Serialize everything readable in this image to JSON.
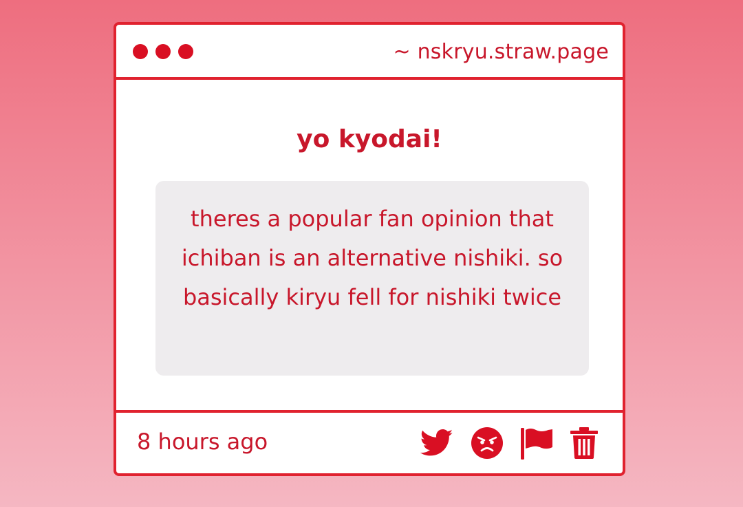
{
  "window": {
    "url": "~ nskryu.straw.page"
  },
  "post": {
    "greeting": "yo kyodai!",
    "message": "theres a popular fan opinion that ichiban is an alternative nishiki. so basically kiryu fell for nishiki twice",
    "timestamp": "8 hours ago"
  },
  "actions": [
    {
      "name": "twitter-share-button",
      "icon": "twitter-icon"
    },
    {
      "name": "angry-reaction-button",
      "icon": "angry-face-icon"
    },
    {
      "name": "report-button",
      "icon": "flag-icon"
    },
    {
      "name": "delete-button",
      "icon": "trash-icon"
    }
  ],
  "colors": {
    "accent": "#d90f23",
    "text": "#c8172b",
    "message_background": "#eeecee",
    "card_background": "#ffffff",
    "page_gradient_top": "#ee6e7f",
    "page_gradient_bottom": "#f5b7c2"
  }
}
